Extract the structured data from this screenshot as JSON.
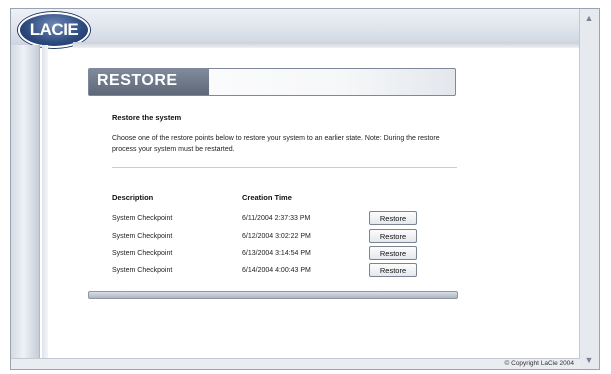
{
  "brand": {
    "logo_text": "LACIE"
  },
  "page": {
    "banner_title": "RESTORE",
    "heading": "Restore the system",
    "description": "Choose one of the restore points below to restore your system to an earlier state. Note: During the restore process your system must be restarted."
  },
  "table": {
    "headers": [
      "Description",
      "Creation Time"
    ],
    "rows": [
      {
        "description": "System Checkpoint",
        "time": "6/11/2004 2:37:33 PM",
        "action": "Restore"
      },
      {
        "description": "System Checkpoint",
        "time": "6/12/2004 3:02:22 PM",
        "action": "Restore"
      },
      {
        "description": "System Checkpoint",
        "time": "6/13/2004 3:14:54 PM",
        "action": "Restore"
      },
      {
        "description": "System Checkpoint",
        "time": "6/14/2004 4:00:43 PM",
        "action": "Restore"
      }
    ]
  },
  "footer": {
    "copyright": "© Copyright LaCie 2004"
  },
  "colors": {
    "brand_blue": "#2d4a7e",
    "banner_gray": "#6b7586"
  },
  "icons": {
    "scroll_up": "chevron-up-icon",
    "scroll_down": "chevron-down-icon"
  }
}
